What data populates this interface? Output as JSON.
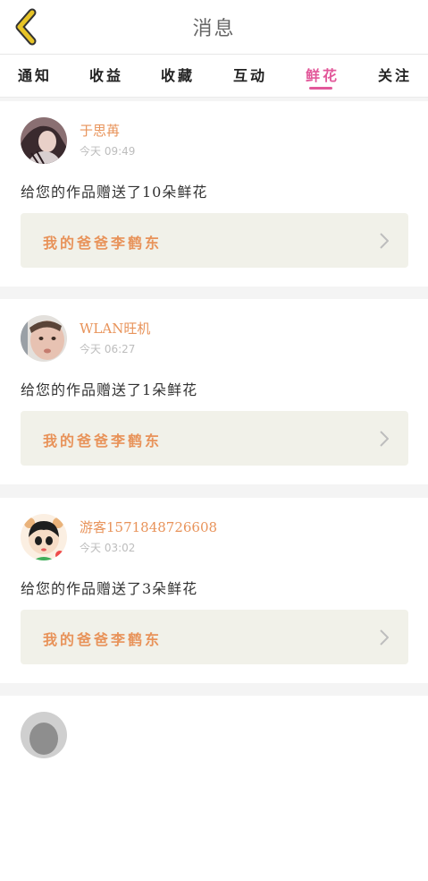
{
  "header": {
    "title": "消息",
    "back_icon": "chevron-left-icon"
  },
  "tabs": [
    {
      "label": "通知"
    },
    {
      "label": "收益"
    },
    {
      "label": "收藏"
    },
    {
      "label": "互动"
    },
    {
      "label": "鲜花",
      "active": true
    },
    {
      "label": "关注"
    }
  ],
  "colors": {
    "accent": "#e2589a",
    "name": "#e8935a",
    "back_icon": "#e7c427",
    "work_bg": "#f1f1e9"
  },
  "messages": [
    {
      "user": "于思苒",
      "time": "今天 09:49",
      "text": "给您的作品赠送了10朵鲜花",
      "work_title": "我的爸爸李鹤东"
    },
    {
      "user": "WLAN旺机",
      "time": "今天 06:27",
      "text": "给您的作品赠送了1朵鲜花",
      "work_title": "我的爸爸李鹤东"
    },
    {
      "user": "游客1571848726608",
      "time": "今天 03:02",
      "text": "给您的作品赠送了3朵鲜花",
      "work_title": "我的爸爸李鹤东"
    }
  ]
}
